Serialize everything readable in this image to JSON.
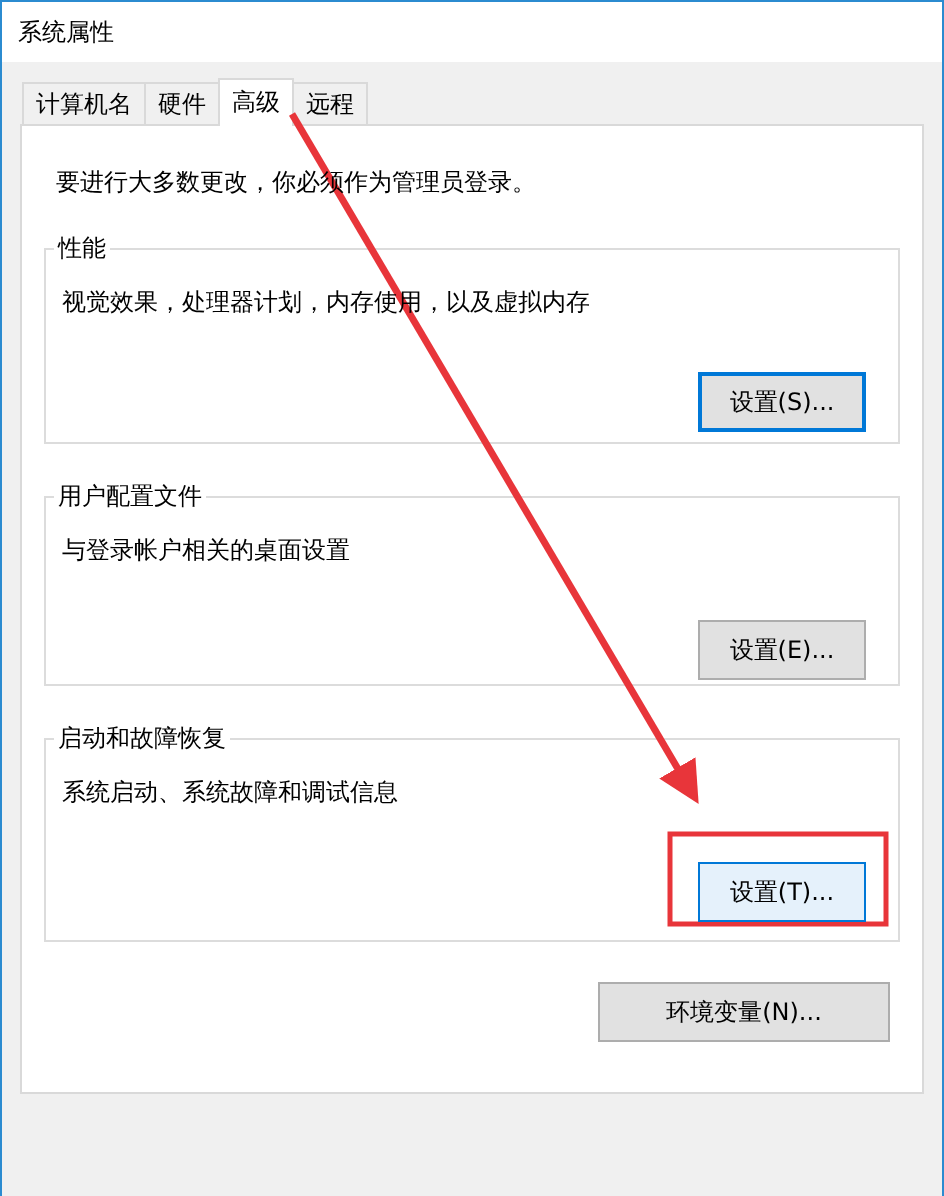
{
  "window": {
    "title": "系统属性"
  },
  "tabs": [
    {
      "label": "计算机名",
      "selected": false
    },
    {
      "label": "硬件",
      "selected": false
    },
    {
      "label": "高级",
      "selected": true
    },
    {
      "label": "远程",
      "selected": false
    }
  ],
  "notice": "要进行大多数更改，你必须作为管理员登录。",
  "groups": [
    {
      "title": "性能",
      "description": "视觉效果，处理器计划，内存使用，以及虚拟内存",
      "button": {
        "label": "设置(S)...",
        "focused": true,
        "hot": false
      }
    },
    {
      "title": "用户配置文件",
      "description": "与登录帐户相关的桌面设置",
      "button": {
        "label": "设置(E)...",
        "focused": false,
        "hot": false
      }
    },
    {
      "title": "启动和故障恢复",
      "description": "系统启动、系统故障和调试信息",
      "button": {
        "label": "设置(T)...",
        "focused": false,
        "hot": true
      }
    }
  ],
  "env_button": {
    "label": "环境变量(N)..."
  }
}
